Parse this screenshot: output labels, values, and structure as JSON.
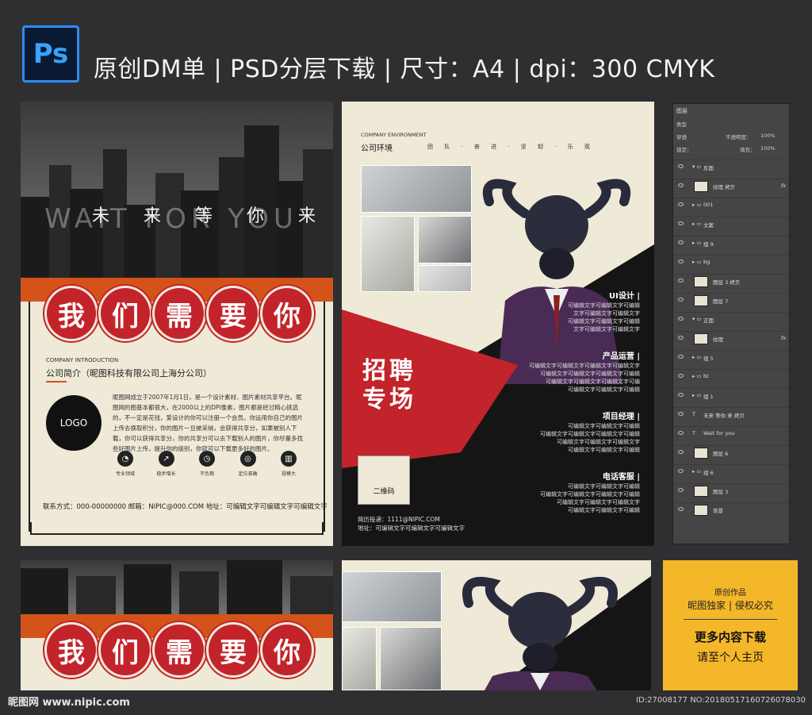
{
  "header": {
    "app_icon": "Ps",
    "title": "原创DM单 | PSD分层下载 | 尺寸：A4 | dpi：300   CMYK"
  },
  "front": {
    "banner_en": "WAIT FOR YOU",
    "banner_cn": "未 来 等 你 来",
    "title_chars": [
      "我",
      "们",
      "需",
      "要",
      "你"
    ],
    "intro_en": "COMPANY INTRODUCTION",
    "intro_cn": "公司简介（昵图科技有限公司上海分公司）",
    "logo": "LOGO",
    "intro_body": "昵图网成立于2007年1月1日，是一个设计素材、图片素材共享平台。昵图网的图基本都很大，在2000以上的DPI像素，图片都是经过精心挑选的，不一定是花钱，爱设计的你可以注册一个会员。你运用你自己的图片上传去换取积分，你的图片一旦被采纳，会获得共享分，如果被别人下载，你可以获得共享分，你的共享分可以去下载别人的图片，你尽量多找些好图片上传，提升你的级别，你就可以下载更多好的图片。",
    "icons": [
      {
        "name": "pie-chart-icon",
        "glyph": "◔",
        "label": "专业领域"
      },
      {
        "name": "growth-chart-icon",
        "glyph": "↗",
        "label": "稳步增长"
      },
      {
        "name": "clock-icon",
        "glyph": "◷",
        "label": "不负期"
      },
      {
        "name": "target-icon",
        "glyph": "◎",
        "label": "定位准确"
      },
      {
        "name": "building-icon",
        "glyph": "▥",
        "label": "规模大"
      }
    ],
    "contact": "联系方式：000-00000000   邮箱：NIPIC@000.COM   地址：可编辑文字可编辑文字可编辑文字"
  },
  "back": {
    "env_en": "COMPANY ENVIRONMENT",
    "env_cn": "公司环境",
    "env_tags": "团 队 · 奋 进 · 坚 韧 · 乐 观",
    "recruit_line1": "招聘",
    "recruit_line2": "专场",
    "qr_label": "二维码",
    "footer_line1": "简历投递：1111@NIPIC.COM",
    "footer_line2": "地址：可编辑文字可编辑文字可编辑文字",
    "jobs": [
      {
        "title": "UI设计 |",
        "text": "可编辑文字可编辑文字可编辑\n文字可编辑文字可编辑文字\n可编辑文字可编辑文字可编辑\n文字可编辑文字可编辑文字"
      },
      {
        "title": "产品运营 |",
        "text": "可编辑文字可编辑文字可编辑文字可编辑文字\n可编辑文字可编辑文字可编辑文字可编辑\n可编辑文字可编辑文字可编辑文字可编\n可编辑文字可编辑文字可编辑"
      },
      {
        "title": "项目经理 |",
        "text": "可编辑文字可编辑文字可编辑\n可编辑文字可编辑文字可编辑文字可编辑\n可编辑文字可编辑文字可编辑文字\n可编辑文字可编辑文字可编辑"
      },
      {
        "title": "电话客服 |",
        "text": "可编辑文字可编辑文字可编辑\n可编辑文字可编辑文字可编辑文字可编辑\n可编辑文字可编辑文字可编辑文字\n可编辑文字可编辑文字可编辑"
      }
    ]
  },
  "layers": {
    "tab": "图层",
    "kind": "类型",
    "mode": "穿透",
    "opacity_label": "不透明度：",
    "opacity_value": "100%",
    "lock_label": "锁定：",
    "fill_label": "填充：",
    "fill_value": "100%",
    "items": [
      {
        "name": "反面",
        "type": "group",
        "fx": ""
      },
      {
        "name": "纹理 拷贝",
        "type": "image",
        "fx": "fx"
      },
      {
        "name": "001",
        "type": "folder",
        "fx": ""
      },
      {
        "name": "文案",
        "type": "folder",
        "fx": ""
      },
      {
        "name": "组 9",
        "type": "folder",
        "fx": ""
      },
      {
        "name": "bg",
        "type": "folder",
        "fx": ""
      },
      {
        "name": "图层 3 拷贝",
        "type": "image",
        "fx": ""
      },
      {
        "name": "图层 7",
        "type": "image",
        "fx": ""
      },
      {
        "name": "正面",
        "type": "group",
        "fx": ""
      },
      {
        "name": "纹理",
        "type": "image",
        "fx": "fx"
      },
      {
        "name": "组 5",
        "type": "folder",
        "fx": ""
      },
      {
        "name": "bt",
        "type": "folder",
        "fx": ""
      },
      {
        "name": "组 1",
        "type": "folder",
        "fx": ""
      },
      {
        "name": "未来 等你 来 拷贝",
        "type": "text",
        "fx": ""
      },
      {
        "name": "Wait for you",
        "type": "text",
        "fx": ""
      },
      {
        "name": "图层 6",
        "type": "image",
        "fx": ""
      },
      {
        "name": "组 6",
        "type": "folder",
        "fx": ""
      },
      {
        "name": "图层 3",
        "type": "image",
        "fx": ""
      },
      {
        "name": "背景",
        "type": "image",
        "fx": ""
      }
    ]
  },
  "promo": {
    "line1": "原创作品",
    "line2": "昵图独家 | 侵权必究",
    "line3": "更多内容下载",
    "line4": "请至个人主页"
  },
  "footer": {
    "site": "昵图网 www.nipic.com",
    "id": "ID:27008177 NO:20180517160726078030"
  }
}
